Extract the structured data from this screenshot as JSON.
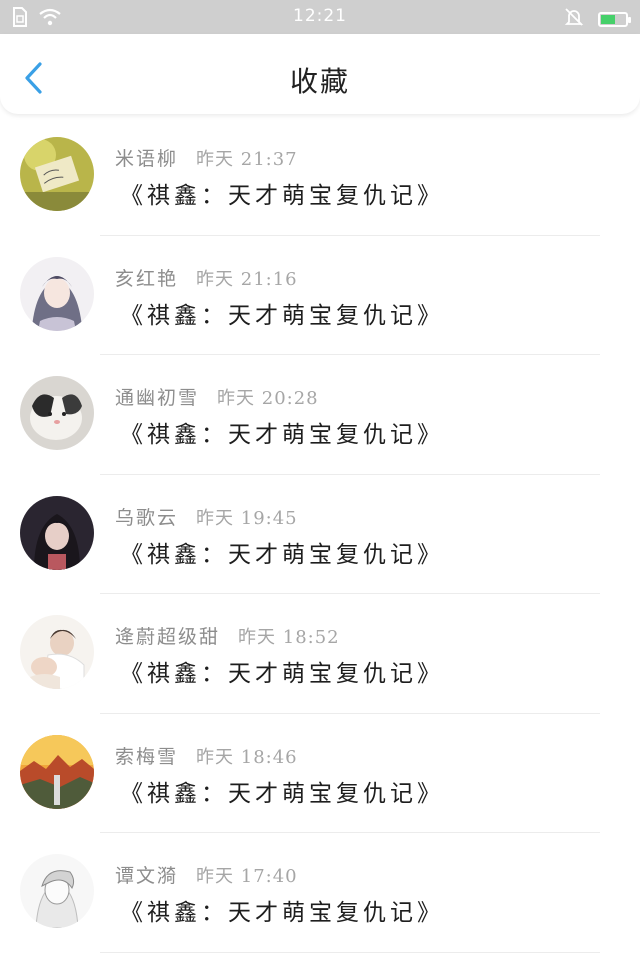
{
  "status_bar": {
    "time": "12:21",
    "icons": [
      "sim-icon",
      "wifi-icon",
      "mute-bell-icon",
      "battery-charging-icon"
    ],
    "battery_level": 0.6,
    "battery_color": "#46d06a"
  },
  "header": {
    "title": "收藏",
    "back_icon": "chevron-left-icon",
    "accent_color": "#3aa0e6"
  },
  "items": [
    {
      "name": "米语柳",
      "time": "昨天 21:37",
      "title": "《祺鑫：天才萌宝复仇记》",
      "avatar": "avatar-note-photo"
    },
    {
      "name": "亥红艳",
      "time": "昨天 21:16",
      "title": "《祺鑫：天才萌宝复仇记》",
      "avatar": "avatar-anime-character"
    },
    {
      "name": "通幽初雪",
      "time": "昨天 20:28",
      "title": "《祺鑫：天才萌宝复仇记》",
      "avatar": "avatar-cat"
    },
    {
      "name": "乌歌云",
      "time": "昨天 19:45",
      "title": "《祺鑫：天才萌宝复仇记》",
      "avatar": "avatar-girl-portrait"
    },
    {
      "name": "逄蔚超级甜",
      "time": "昨天 18:52",
      "title": "《祺鑫：天才萌宝复仇记》",
      "avatar": "avatar-mother-baby"
    },
    {
      "name": "索梅雪",
      "time": "昨天 18:46",
      "title": "《祺鑫：天才萌宝复仇记》",
      "avatar": "avatar-landscape"
    },
    {
      "name": "谭文漪",
      "time": "昨天 17:40",
      "title": "《祺鑫：天才萌宝复仇记》",
      "avatar": "avatar-sketch-boy"
    }
  ]
}
